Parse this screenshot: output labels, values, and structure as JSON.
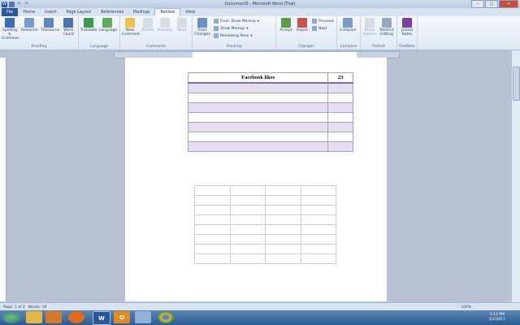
{
  "window": {
    "title": "Document5 - Microsoft Word (Trial)"
  },
  "tabs": [
    "File",
    "Home",
    "Insert",
    "Page Layout",
    "References",
    "Mailings",
    "Review",
    "View"
  ],
  "active_tab": "Review",
  "ribbon": {
    "proofing": {
      "label": "Proofing",
      "spelling": "Spelling & Grammar",
      "research": "Research",
      "thesaurus": "Thesaurus",
      "word_count": "Word Count"
    },
    "language": {
      "label": "Language",
      "translate": "Translate",
      "language": "Language"
    },
    "comments": {
      "label": "Comments",
      "new": "New Comment",
      "delete": "Delete",
      "previous": "Previous",
      "next": "Next"
    },
    "tracking": {
      "label": "Tracking",
      "track_changes": "Track Changes",
      "final": "Final: Show Markup",
      "show_markup": "Show Markup",
      "reviewing_pane": "Reviewing Pane"
    },
    "changes": {
      "label": "Changes",
      "accept": "Accept",
      "reject": "Reject",
      "previous": "Previous",
      "next": "Next"
    },
    "compare": {
      "label": "Compare",
      "compare": "Compare"
    },
    "protect": {
      "label": "Protect",
      "block_authors": "Block Authors",
      "restrict_editing": "Restrict Editing"
    },
    "onenote": {
      "label": "OneNote",
      "linked_notes": "Linked Notes"
    }
  },
  "table1": {
    "header": [
      "Facebook likes",
      "23"
    ]
  },
  "status": {
    "page": "Page: 1 of 2",
    "words": "Words: 19",
    "zoom": "100%"
  },
  "taskbar": {
    "time": "5:12 PM",
    "date": "3/2/2011"
  }
}
